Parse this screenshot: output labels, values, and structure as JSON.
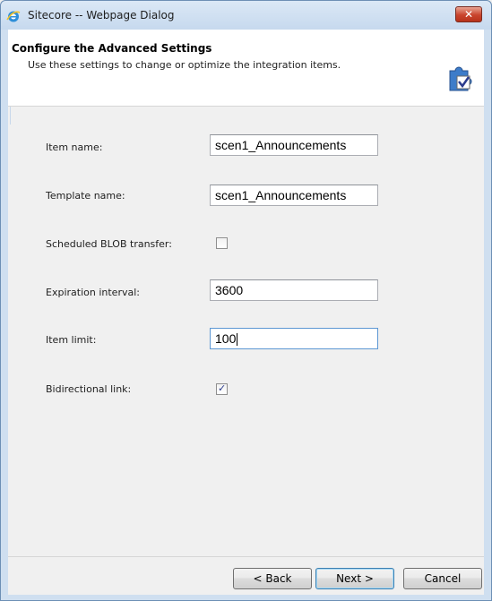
{
  "window": {
    "title": "Sitecore -- Webpage Dialog",
    "close_label": "✕"
  },
  "header": {
    "title": "Configure the Advanced Settings",
    "subtitle": "Use these settings to change or optimize the integration items."
  },
  "form": {
    "item_name": {
      "label": "Item name:",
      "value": "scen1_Announcements"
    },
    "template_name": {
      "label": "Template name:",
      "value": "scen1_Announcements"
    },
    "scheduled_blob": {
      "label": "Scheduled BLOB transfer:",
      "checked": false
    },
    "expiration_interval": {
      "label": "Expiration interval:",
      "value": "3600"
    },
    "item_limit": {
      "label": "Item limit:",
      "value": "100"
    },
    "bidirectional_link": {
      "label": "Bidirectional link:",
      "checked": true,
      "check_mark": "✓"
    }
  },
  "footer": {
    "back_label": "< Back",
    "next_label": "Next >",
    "cancel_label": "Cancel"
  },
  "colors": {
    "window_frame": "#cfdff0",
    "close_button": "#c9442d",
    "focus_border": "#5c97d3"
  }
}
